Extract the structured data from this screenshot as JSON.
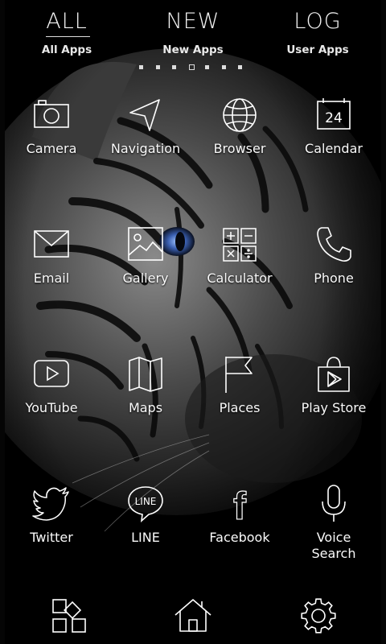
{
  "tabs": [
    {
      "title": "ALL",
      "subtitle": "All Apps",
      "active": true
    },
    {
      "title": "NEW",
      "subtitle": "New Apps",
      "active": false
    },
    {
      "title": "LOG",
      "subtitle": "User Apps",
      "active": false
    }
  ],
  "pager": {
    "pages": 7,
    "current": 4
  },
  "apps": [
    {
      "label": "Camera",
      "icon": "camera-icon"
    },
    {
      "label": "Navigation",
      "icon": "navigation-icon"
    },
    {
      "label": "Browser",
      "icon": "globe-icon"
    },
    {
      "label": "Calendar",
      "icon": "calendar-icon",
      "day": "24"
    },
    {
      "label": "Email",
      "icon": "envelope-icon"
    },
    {
      "label": "Gallery",
      "icon": "image-icon"
    },
    {
      "label": "Calculator",
      "icon": "calculator-icon"
    },
    {
      "label": "Phone",
      "icon": "phone-icon"
    },
    {
      "label": "YouTube",
      "icon": "play-icon"
    },
    {
      "label": "Maps",
      "icon": "map-icon"
    },
    {
      "label": "Places",
      "icon": "flag-icon"
    },
    {
      "label": "Play Store",
      "icon": "shopping-bag-icon"
    },
    {
      "label": "Twitter",
      "icon": "bird-icon"
    },
    {
      "label": "LINE",
      "icon": "line-bubble-icon",
      "badge": "LINE"
    },
    {
      "label": "Facebook",
      "icon": "facebook-f-icon",
      "glyph": "f"
    },
    {
      "label": "Voice\nSearch",
      "icon": "microphone-icon"
    }
  ],
  "dock": [
    {
      "name": "widgets",
      "icon": "grid-squares-icon"
    },
    {
      "name": "home",
      "icon": "home-icon"
    },
    {
      "name": "settings",
      "icon": "gear-icon"
    }
  ],
  "colors": {
    "background": "#000000",
    "foreground": "#ffffff",
    "eye": "#3a5fb0"
  }
}
